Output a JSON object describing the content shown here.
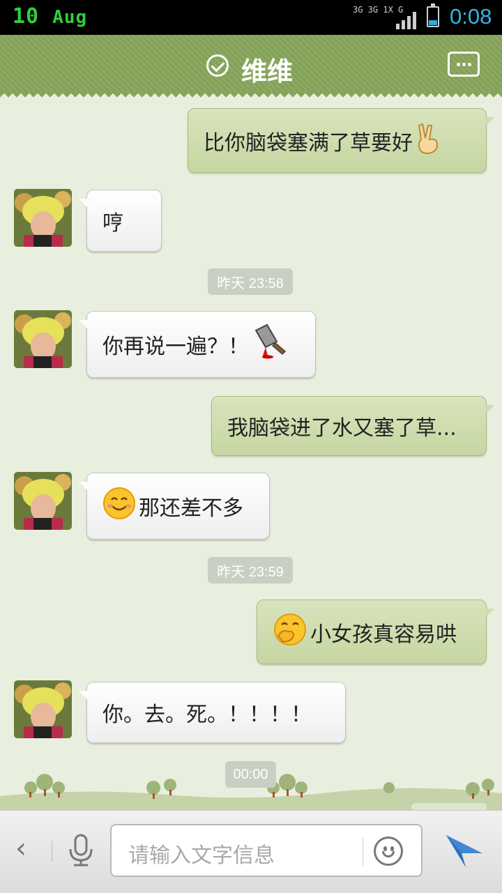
{
  "status_bar": {
    "date_day": "10",
    "date_month": "Aug",
    "network_line1": "3G 3G 1X G",
    "time": "0:08"
  },
  "header": {
    "title": "维维"
  },
  "messages": [
    {
      "side": "me",
      "text": "比你脑袋塞满了草要好",
      "emoji": "victory-hand"
    },
    {
      "side": "other",
      "text": "哼"
    },
    {
      "side": "time",
      "text": "昨天 23:58"
    },
    {
      "side": "other",
      "text": "你再说一遍？！",
      "emoji": "bloody-cleaver"
    },
    {
      "side": "me",
      "text": "我脑袋进了水又塞了草..."
    },
    {
      "side": "other",
      "text": "那还差不多",
      "emoji": "smile-face"
    },
    {
      "side": "time",
      "text": "昨天 23:59"
    },
    {
      "side": "me",
      "text": "小女孩真容易哄",
      "emoji": "giggle-face"
    },
    {
      "side": "other",
      "text": "你。去。死。！！！！"
    },
    {
      "side": "time",
      "text": "00:00"
    }
  ],
  "input_bar": {
    "placeholder": "请输入文字信息"
  },
  "colors": {
    "title_bar": "#86a55a",
    "my_bubble": "#c6d6a1",
    "background": "#e8efdf",
    "clock": "#33b5e5",
    "date": "#2fcf3a"
  }
}
